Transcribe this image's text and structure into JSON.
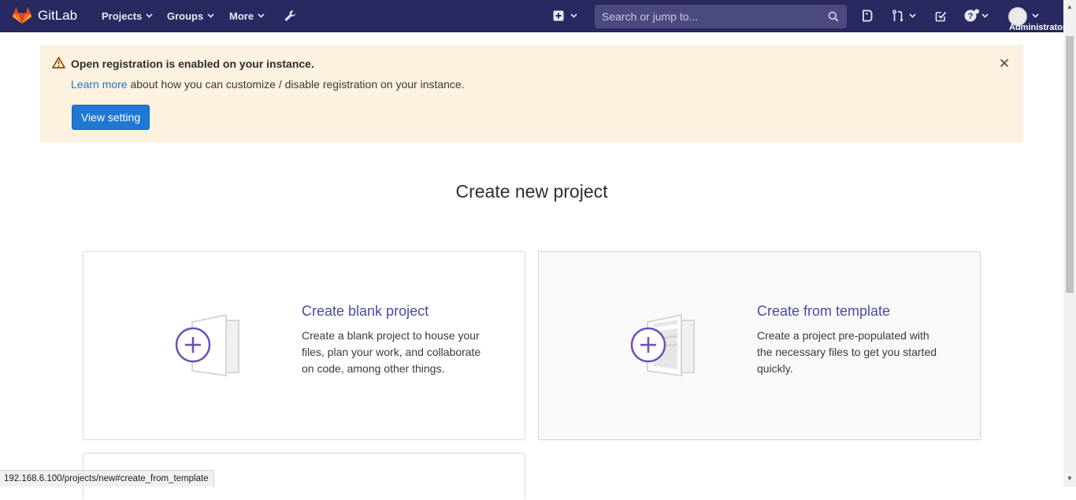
{
  "navbar": {
    "brand": "GitLab",
    "links": [
      {
        "label": "Projects"
      },
      {
        "label": "Groups"
      },
      {
        "label": "More"
      }
    ],
    "search_placeholder": "Search or jump to...",
    "user_label": "Administrator"
  },
  "alert": {
    "title": "Open registration is enabled on your instance.",
    "link_text": "Learn more",
    "body_rest": " about how you can customize / disable registration on your instance.",
    "button": "View setting"
  },
  "page": {
    "title": "Create new project"
  },
  "panels": [
    {
      "title": "Create blank project",
      "description": "Create a blank project to house your files, plan your work, and collaborate on code, among other things."
    },
    {
      "title": "Create from template",
      "description": "Create a project pre-populated with the necessary files to get you started quickly."
    }
  ],
  "status_bar": {
    "url": "192.168.6.100/projects/new#create_from_template"
  },
  "colors": {
    "navbar": "#292961",
    "accent": "#1f78d1",
    "panel_title": "#4b4ba3",
    "alert_bg": "#fdf1df",
    "illustration_purple": "#6b4fbb"
  }
}
